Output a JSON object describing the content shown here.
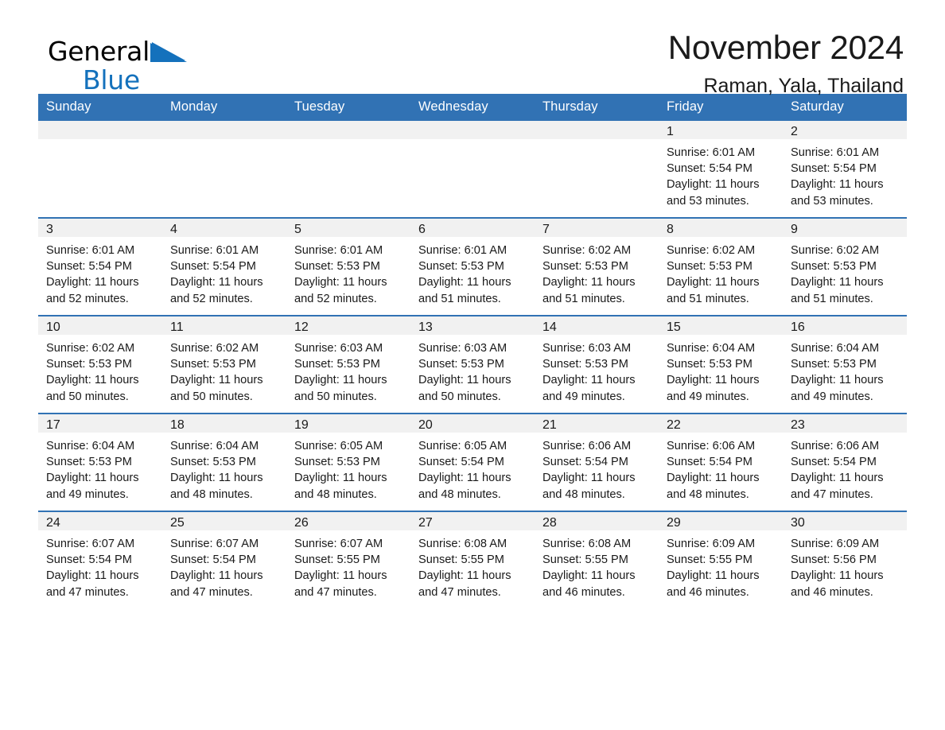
{
  "brand": {
    "name_part1": "General",
    "name_part2": "Blue",
    "triangle_color": "#1471bc"
  },
  "header": {
    "title": "November 2024",
    "subtitle": "Raman, Yala, Thailand"
  },
  "theme": {
    "header_blue": "#3172b4",
    "daynum_band": "#f1f1f1",
    "text": "#1a1a1a"
  },
  "weekday_headers": [
    "Sunday",
    "Monday",
    "Tuesday",
    "Wednesday",
    "Thursday",
    "Friday",
    "Saturday"
  ],
  "weeks": [
    [
      {
        "day": "",
        "empty": true
      },
      {
        "day": "",
        "empty": true
      },
      {
        "day": "",
        "empty": true
      },
      {
        "day": "",
        "empty": true
      },
      {
        "day": "",
        "empty": true
      },
      {
        "day": "1",
        "sunrise": "Sunrise: 6:01 AM",
        "sunset": "Sunset: 5:54 PM",
        "daylight_line1": "Daylight: 11 hours",
        "daylight_line2": "and 53 minutes."
      },
      {
        "day": "2",
        "sunrise": "Sunrise: 6:01 AM",
        "sunset": "Sunset: 5:54 PM",
        "daylight_line1": "Daylight: 11 hours",
        "daylight_line2": "and 53 minutes."
      }
    ],
    [
      {
        "day": "3",
        "sunrise": "Sunrise: 6:01 AM",
        "sunset": "Sunset: 5:54 PM",
        "daylight_line1": "Daylight: 11 hours",
        "daylight_line2": "and 52 minutes."
      },
      {
        "day": "4",
        "sunrise": "Sunrise: 6:01 AM",
        "sunset": "Sunset: 5:54 PM",
        "daylight_line1": "Daylight: 11 hours",
        "daylight_line2": "and 52 minutes."
      },
      {
        "day": "5",
        "sunrise": "Sunrise: 6:01 AM",
        "sunset": "Sunset: 5:53 PM",
        "daylight_line1": "Daylight: 11 hours",
        "daylight_line2": "and 52 minutes."
      },
      {
        "day": "6",
        "sunrise": "Sunrise: 6:01 AM",
        "sunset": "Sunset: 5:53 PM",
        "daylight_line1": "Daylight: 11 hours",
        "daylight_line2": "and 51 minutes."
      },
      {
        "day": "7",
        "sunrise": "Sunrise: 6:02 AM",
        "sunset": "Sunset: 5:53 PM",
        "daylight_line1": "Daylight: 11 hours",
        "daylight_line2": "and 51 minutes."
      },
      {
        "day": "8",
        "sunrise": "Sunrise: 6:02 AM",
        "sunset": "Sunset: 5:53 PM",
        "daylight_line1": "Daylight: 11 hours",
        "daylight_line2": "and 51 minutes."
      },
      {
        "day": "9",
        "sunrise": "Sunrise: 6:02 AM",
        "sunset": "Sunset: 5:53 PM",
        "daylight_line1": "Daylight: 11 hours",
        "daylight_line2": "and 51 minutes."
      }
    ],
    [
      {
        "day": "10",
        "sunrise": "Sunrise: 6:02 AM",
        "sunset": "Sunset: 5:53 PM",
        "daylight_line1": "Daylight: 11 hours",
        "daylight_line2": "and 50 minutes."
      },
      {
        "day": "11",
        "sunrise": "Sunrise: 6:02 AM",
        "sunset": "Sunset: 5:53 PM",
        "daylight_line1": "Daylight: 11 hours",
        "daylight_line2": "and 50 minutes."
      },
      {
        "day": "12",
        "sunrise": "Sunrise: 6:03 AM",
        "sunset": "Sunset: 5:53 PM",
        "daylight_line1": "Daylight: 11 hours",
        "daylight_line2": "and 50 minutes."
      },
      {
        "day": "13",
        "sunrise": "Sunrise: 6:03 AM",
        "sunset": "Sunset: 5:53 PM",
        "daylight_line1": "Daylight: 11 hours",
        "daylight_line2": "and 50 minutes."
      },
      {
        "day": "14",
        "sunrise": "Sunrise: 6:03 AM",
        "sunset": "Sunset: 5:53 PM",
        "daylight_line1": "Daylight: 11 hours",
        "daylight_line2": "and 49 minutes."
      },
      {
        "day": "15",
        "sunrise": "Sunrise: 6:04 AM",
        "sunset": "Sunset: 5:53 PM",
        "daylight_line1": "Daylight: 11 hours",
        "daylight_line2": "and 49 minutes."
      },
      {
        "day": "16",
        "sunrise": "Sunrise: 6:04 AM",
        "sunset": "Sunset: 5:53 PM",
        "daylight_line1": "Daylight: 11 hours",
        "daylight_line2": "and 49 minutes."
      }
    ],
    [
      {
        "day": "17",
        "sunrise": "Sunrise: 6:04 AM",
        "sunset": "Sunset: 5:53 PM",
        "daylight_line1": "Daylight: 11 hours",
        "daylight_line2": "and 49 minutes."
      },
      {
        "day": "18",
        "sunrise": "Sunrise: 6:04 AM",
        "sunset": "Sunset: 5:53 PM",
        "daylight_line1": "Daylight: 11 hours",
        "daylight_line2": "and 48 minutes."
      },
      {
        "day": "19",
        "sunrise": "Sunrise: 6:05 AM",
        "sunset": "Sunset: 5:53 PM",
        "daylight_line1": "Daylight: 11 hours",
        "daylight_line2": "and 48 minutes."
      },
      {
        "day": "20",
        "sunrise": "Sunrise: 6:05 AM",
        "sunset": "Sunset: 5:54 PM",
        "daylight_line1": "Daylight: 11 hours",
        "daylight_line2": "and 48 minutes."
      },
      {
        "day": "21",
        "sunrise": "Sunrise: 6:06 AM",
        "sunset": "Sunset: 5:54 PM",
        "daylight_line1": "Daylight: 11 hours",
        "daylight_line2": "and 48 minutes."
      },
      {
        "day": "22",
        "sunrise": "Sunrise: 6:06 AM",
        "sunset": "Sunset: 5:54 PM",
        "daylight_line1": "Daylight: 11 hours",
        "daylight_line2": "and 48 minutes."
      },
      {
        "day": "23",
        "sunrise": "Sunrise: 6:06 AM",
        "sunset": "Sunset: 5:54 PM",
        "daylight_line1": "Daylight: 11 hours",
        "daylight_line2": "and 47 minutes."
      }
    ],
    [
      {
        "day": "24",
        "sunrise": "Sunrise: 6:07 AM",
        "sunset": "Sunset: 5:54 PM",
        "daylight_line1": "Daylight: 11 hours",
        "daylight_line2": "and 47 minutes."
      },
      {
        "day": "25",
        "sunrise": "Sunrise: 6:07 AM",
        "sunset": "Sunset: 5:54 PM",
        "daylight_line1": "Daylight: 11 hours",
        "daylight_line2": "and 47 minutes."
      },
      {
        "day": "26",
        "sunrise": "Sunrise: 6:07 AM",
        "sunset": "Sunset: 5:55 PM",
        "daylight_line1": "Daylight: 11 hours",
        "daylight_line2": "and 47 minutes."
      },
      {
        "day": "27",
        "sunrise": "Sunrise: 6:08 AM",
        "sunset": "Sunset: 5:55 PM",
        "daylight_line1": "Daylight: 11 hours",
        "daylight_line2": "and 47 minutes."
      },
      {
        "day": "28",
        "sunrise": "Sunrise: 6:08 AM",
        "sunset": "Sunset: 5:55 PM",
        "daylight_line1": "Daylight: 11 hours",
        "daylight_line2": "and 46 minutes."
      },
      {
        "day": "29",
        "sunrise": "Sunrise: 6:09 AM",
        "sunset": "Sunset: 5:55 PM",
        "daylight_line1": "Daylight: 11 hours",
        "daylight_line2": "and 46 minutes."
      },
      {
        "day": "30",
        "sunrise": "Sunrise: 6:09 AM",
        "sunset": "Sunset: 5:56 PM",
        "daylight_line1": "Daylight: 11 hours",
        "daylight_line2": "and 46 minutes."
      }
    ]
  ]
}
